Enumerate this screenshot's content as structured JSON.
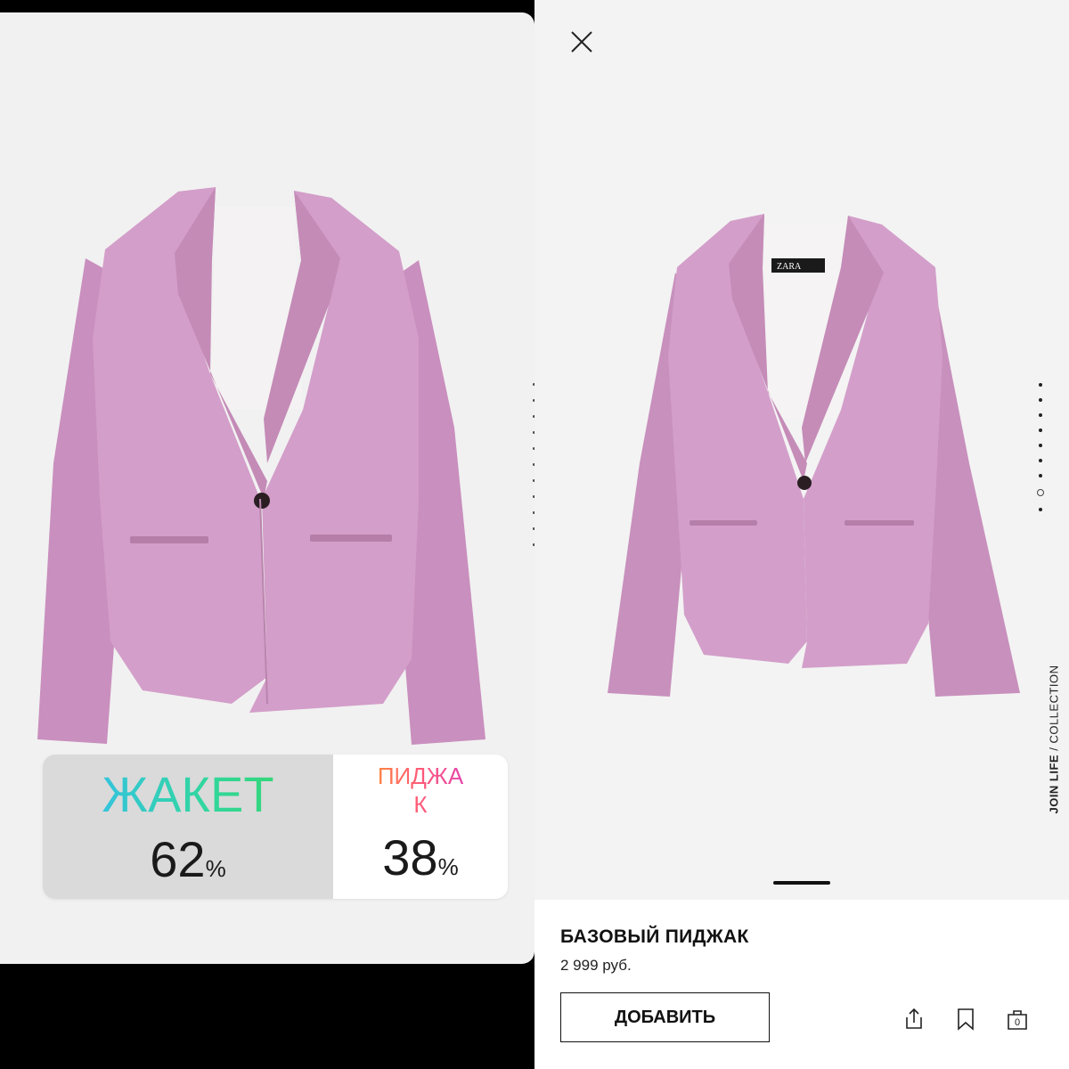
{
  "story": {
    "poll": {
      "option_a": {
        "label": "ЖАКЕТ",
        "percent": "62",
        "unit": "%",
        "share": 0.62
      },
      "option_b": {
        "label": "ПИДЖАК",
        "percent": "38",
        "unit": "%",
        "share": 0.38
      },
      "colors": {
        "a_gradient": [
          "#35b9ff",
          "#35d65a"
        ],
        "b_gradient": [
          "#ff8a3d",
          "#e040b0"
        ]
      }
    },
    "jacket_color": "#cf9cc6"
  },
  "app": {
    "close_icon": "close-icon",
    "collection_tag": {
      "brand": "JOIN LIFE",
      "separator": " / ",
      "label": "COLLECTION"
    },
    "label_brand": "ZARA",
    "gallery": {
      "image_count": 8,
      "active_index": 7
    },
    "product": {
      "title": "БАЗОВЫЙ ПИДЖАК",
      "price": "2 999 руб."
    },
    "add_button_label": "ДОБАВИТЬ",
    "icons": [
      "share-icon",
      "bookmark-icon",
      "cart-icon"
    ],
    "cart_count": "0"
  }
}
